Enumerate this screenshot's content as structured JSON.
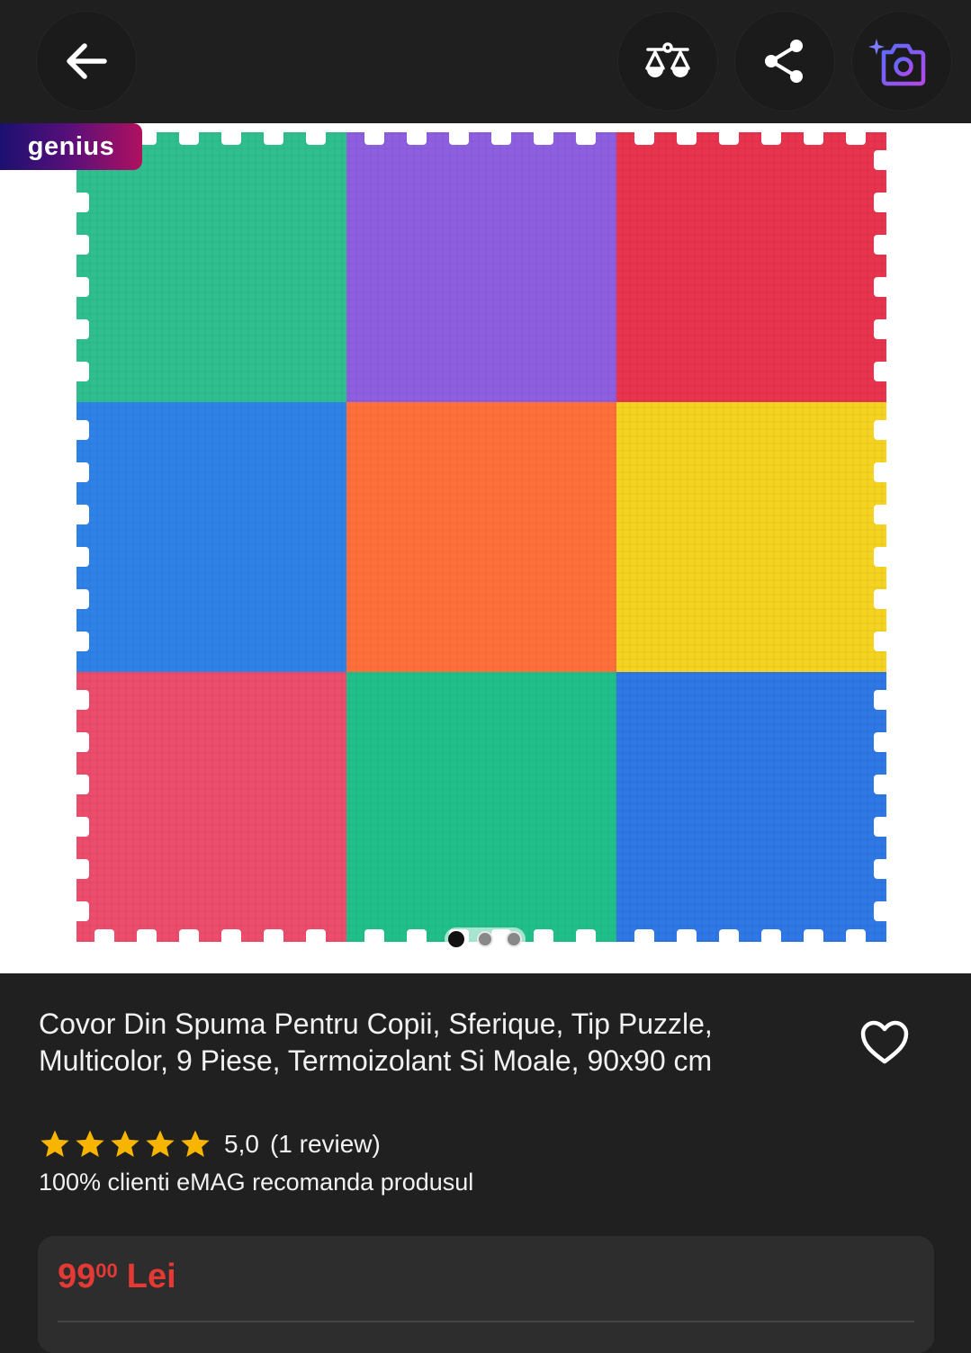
{
  "header": {
    "back_icon": "arrow-left-icon",
    "compare_icon": "balance-scale-icon",
    "share_icon": "share-icon",
    "camera_icon": "camera-search-icon"
  },
  "gallery": {
    "badge": "genius",
    "current_image": 1,
    "total_images": 3,
    "tiles": [
      "#2fbf8f",
      "#8e5fe0",
      "#e8344f",
      "#2f82e8",
      "#ff6f3c",
      "#f5d321",
      "#ec4d6c",
      "#21c08a",
      "#2f78e6"
    ]
  },
  "product": {
    "title": "Covor Din Spuma Pentru Copii, Sferique, Tip Puzzle, Multicolor, 9 Piese, Termoizolant Si Moale, 90x90 cm",
    "favorite_icon": "heart-outline-icon",
    "rating": {
      "stars": 5,
      "score": "5,0",
      "count_text": "(1 review)"
    },
    "recommend_text": "100% clienti eMAG recomanda produsul"
  },
  "price": {
    "integer": "99",
    "decimals": "00",
    "currency": "Lei",
    "color": "#e53935"
  }
}
